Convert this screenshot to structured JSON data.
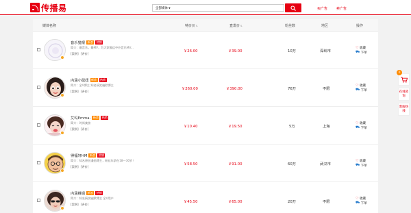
{
  "brand": {
    "name": "传播易",
    "accent": "#e60012"
  },
  "search": {
    "category": "全部媒体",
    "placeholder": ""
  },
  "top_links": {
    "buy_ads": "买广告",
    "sell_ads": "卖广告"
  },
  "columns": {
    "media_name": "媒体名称",
    "special_price": "特价价",
    "direct_price": "直发价",
    "fans": "粉丝数",
    "region": "地区",
    "action": "操作"
  },
  "rows": [
    {
      "name": "音乐猎报",
      "tag1": "新浪",
      "tag2": "热销",
      "intro": "简介：最音乐，最MV，为大家搬运中外音乐MV...",
      "case_link": "[案例]",
      "review_link": "[评价]",
      "special_price": "￥26.00",
      "direct_price": "￥39.00",
      "fans": "10万",
      "region": "深圳市",
      "favorite": "收藏",
      "order": "下单"
    },
    {
      "name": "内涵小鼠妞",
      "tag1": "新浪",
      "tag2": "热销",
      "intro": "简介：全V博主 知名搞笑幽默博主",
      "case_link": "[案例]",
      "review_link": "[评价]",
      "special_price": "￥260.00",
      "direct_price": "￥390.00",
      "fans": "76万",
      "region": "不限",
      "favorite": "收藏",
      "order": "下单"
    },
    {
      "name": "艾玛Emma-",
      "tag1": "新浪",
      "tag2": "热销",
      "intro": "简介：时尚美妆",
      "case_link": "[案例]",
      "review_link": "[评价]",
      "special_price": "￥10.40",
      "direct_price": "￥19.50",
      "fans": "5万",
      "region": "上海",
      "favorite": "收藏",
      "order": "下单"
    },
    {
      "name": "得福轩HM",
      "tag1": "新浪",
      "tag2": "热销",
      "intro": "简介：知名原创漫画博主，粉丝年龄在18—30岁！",
      "case_link": "[案例]",
      "review_link": "[评价]",
      "special_price": "￥58.50",
      "direct_price": "￥91.00",
      "fans": "60万",
      "region": "武汉市",
      "favorite": "收藏",
      "order": "下单"
    },
    {
      "name": "内涵蜂姐",
      "tag1": "新浪",
      "tag2": "热销",
      "intro": "简介：知名搞笑幽默博主 全V用户",
      "case_link": "[案例]",
      "review_link": "[评价]",
      "special_price": "￥45.50",
      "direct_price": "￥65.00",
      "fans": "20万",
      "region": "不限",
      "favorite": "收藏",
      "order": "下单"
    }
  ],
  "sidebar": {
    "cart_count": "0",
    "online_consult": "在线咨询",
    "hotline": "客服热线"
  }
}
